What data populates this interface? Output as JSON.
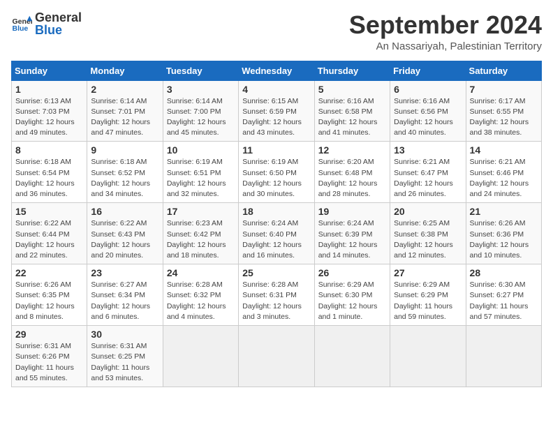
{
  "header": {
    "logo_general": "General",
    "logo_blue": "Blue",
    "month_title": "September 2024",
    "location": "An Nassariyah, Palestinian Territory"
  },
  "days_of_week": [
    "Sunday",
    "Monday",
    "Tuesday",
    "Wednesday",
    "Thursday",
    "Friday",
    "Saturday"
  ],
  "weeks": [
    [
      {
        "day": "1",
        "info": "Sunrise: 6:13 AM\nSunset: 7:03 PM\nDaylight: 12 hours\nand 49 minutes."
      },
      {
        "day": "2",
        "info": "Sunrise: 6:14 AM\nSunset: 7:01 PM\nDaylight: 12 hours\nand 47 minutes."
      },
      {
        "day": "3",
        "info": "Sunrise: 6:14 AM\nSunset: 7:00 PM\nDaylight: 12 hours\nand 45 minutes."
      },
      {
        "day": "4",
        "info": "Sunrise: 6:15 AM\nSunset: 6:59 PM\nDaylight: 12 hours\nand 43 minutes."
      },
      {
        "day": "5",
        "info": "Sunrise: 6:16 AM\nSunset: 6:58 PM\nDaylight: 12 hours\nand 41 minutes."
      },
      {
        "day": "6",
        "info": "Sunrise: 6:16 AM\nSunset: 6:56 PM\nDaylight: 12 hours\nand 40 minutes."
      },
      {
        "day": "7",
        "info": "Sunrise: 6:17 AM\nSunset: 6:55 PM\nDaylight: 12 hours\nand 38 minutes."
      }
    ],
    [
      {
        "day": "8",
        "info": "Sunrise: 6:18 AM\nSunset: 6:54 PM\nDaylight: 12 hours\nand 36 minutes."
      },
      {
        "day": "9",
        "info": "Sunrise: 6:18 AM\nSunset: 6:52 PM\nDaylight: 12 hours\nand 34 minutes."
      },
      {
        "day": "10",
        "info": "Sunrise: 6:19 AM\nSunset: 6:51 PM\nDaylight: 12 hours\nand 32 minutes."
      },
      {
        "day": "11",
        "info": "Sunrise: 6:19 AM\nSunset: 6:50 PM\nDaylight: 12 hours\nand 30 minutes."
      },
      {
        "day": "12",
        "info": "Sunrise: 6:20 AM\nSunset: 6:48 PM\nDaylight: 12 hours\nand 28 minutes."
      },
      {
        "day": "13",
        "info": "Sunrise: 6:21 AM\nSunset: 6:47 PM\nDaylight: 12 hours\nand 26 minutes."
      },
      {
        "day": "14",
        "info": "Sunrise: 6:21 AM\nSunset: 6:46 PM\nDaylight: 12 hours\nand 24 minutes."
      }
    ],
    [
      {
        "day": "15",
        "info": "Sunrise: 6:22 AM\nSunset: 6:44 PM\nDaylight: 12 hours\nand 22 minutes."
      },
      {
        "day": "16",
        "info": "Sunrise: 6:22 AM\nSunset: 6:43 PM\nDaylight: 12 hours\nand 20 minutes."
      },
      {
        "day": "17",
        "info": "Sunrise: 6:23 AM\nSunset: 6:42 PM\nDaylight: 12 hours\nand 18 minutes."
      },
      {
        "day": "18",
        "info": "Sunrise: 6:24 AM\nSunset: 6:40 PM\nDaylight: 12 hours\nand 16 minutes."
      },
      {
        "day": "19",
        "info": "Sunrise: 6:24 AM\nSunset: 6:39 PM\nDaylight: 12 hours\nand 14 minutes."
      },
      {
        "day": "20",
        "info": "Sunrise: 6:25 AM\nSunset: 6:38 PM\nDaylight: 12 hours\nand 12 minutes."
      },
      {
        "day": "21",
        "info": "Sunrise: 6:26 AM\nSunset: 6:36 PM\nDaylight: 12 hours\nand 10 minutes."
      }
    ],
    [
      {
        "day": "22",
        "info": "Sunrise: 6:26 AM\nSunset: 6:35 PM\nDaylight: 12 hours\nand 8 minutes."
      },
      {
        "day": "23",
        "info": "Sunrise: 6:27 AM\nSunset: 6:34 PM\nDaylight: 12 hours\nand 6 minutes."
      },
      {
        "day": "24",
        "info": "Sunrise: 6:28 AM\nSunset: 6:32 PM\nDaylight: 12 hours\nand 4 minutes."
      },
      {
        "day": "25",
        "info": "Sunrise: 6:28 AM\nSunset: 6:31 PM\nDaylight: 12 hours\nand 3 minutes."
      },
      {
        "day": "26",
        "info": "Sunrise: 6:29 AM\nSunset: 6:30 PM\nDaylight: 12 hours\nand 1 minute."
      },
      {
        "day": "27",
        "info": "Sunrise: 6:29 AM\nSunset: 6:29 PM\nDaylight: 11 hours\nand 59 minutes."
      },
      {
        "day": "28",
        "info": "Sunrise: 6:30 AM\nSunset: 6:27 PM\nDaylight: 11 hours\nand 57 minutes."
      }
    ],
    [
      {
        "day": "29",
        "info": "Sunrise: 6:31 AM\nSunset: 6:26 PM\nDaylight: 11 hours\nand 55 minutes."
      },
      {
        "day": "30",
        "info": "Sunrise: 6:31 AM\nSunset: 6:25 PM\nDaylight: 11 hours\nand 53 minutes."
      },
      {
        "day": "",
        "info": ""
      },
      {
        "day": "",
        "info": ""
      },
      {
        "day": "",
        "info": ""
      },
      {
        "day": "",
        "info": ""
      },
      {
        "day": "",
        "info": ""
      }
    ]
  ]
}
